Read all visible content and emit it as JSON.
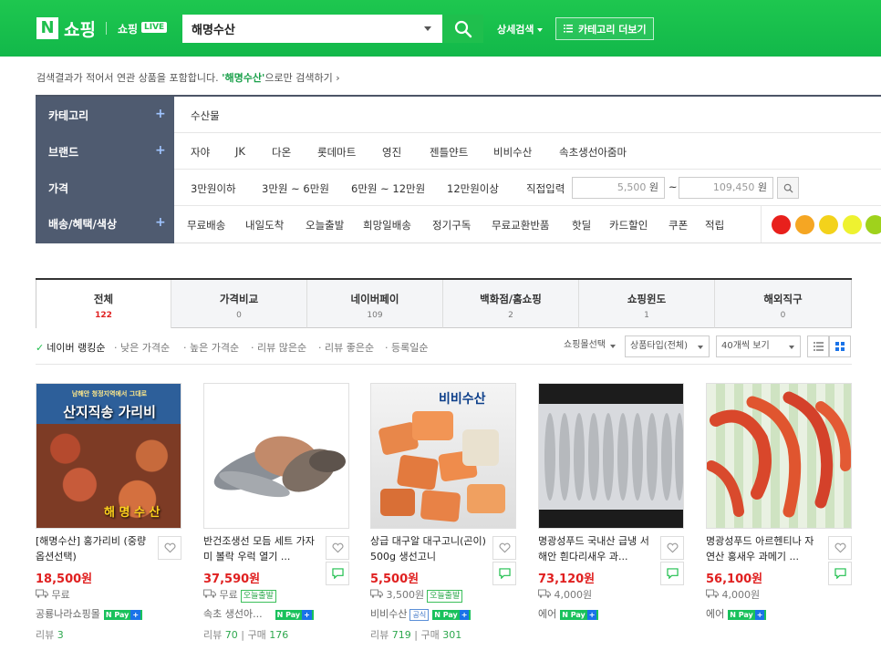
{
  "header": {
    "logo_n": "N",
    "logo_text": "쇼핑",
    "live_text": "쇼핑",
    "live_badge": "LIVE",
    "search_value": "해명수산",
    "advanced_search": "상세검색",
    "category_button": "카테고리 더보기"
  },
  "notice": {
    "prefix": "검색결과가 적어서 연관 상품을 포함합니다.",
    "keyword": "'해명수산'",
    "suffix": "으로만 검색하기 ›"
  },
  "filter": {
    "category": {
      "label": "카테고리",
      "items": [
        "수산물"
      ]
    },
    "brand": {
      "label": "브랜드",
      "items": [
        "자야",
        "JK",
        "다온",
        "롯데마트",
        "영진",
        "젠틀얀트",
        "비비수산",
        "속초생선아줌마"
      ]
    },
    "price": {
      "label": "가격",
      "items": [
        "3만원이하",
        "3만원 ~ 6만원",
        "6만원 ~ 12만원",
        "12만원이상"
      ],
      "direct_label": "직접입력",
      "min": "5,500",
      "max": "109,450",
      "won": "원",
      "tilde": "~"
    },
    "delivery": {
      "label": "배송/혜택/색상",
      "items": [
        "무료배송",
        "내일도착",
        "오늘출발",
        "희망일배송",
        "정기구독",
        "무료교환반품",
        "핫딜",
        "카드할인",
        "쿠폰",
        "적립"
      ],
      "colors": [
        "#e8201c",
        "#f5a623",
        "#f3d21b",
        "#eef230",
        "#9fd21c"
      ]
    },
    "plus": "+"
  },
  "tabs": [
    {
      "label": "전체",
      "count": "122"
    },
    {
      "label": "가격비교",
      "count": "0"
    },
    {
      "label": "네이버페이",
      "count": "109"
    },
    {
      "label": "백화점/홈쇼핑",
      "count": "2"
    },
    {
      "label": "쇼핑윈도",
      "count": "1"
    },
    {
      "label": "해외직구",
      "count": "0"
    }
  ],
  "sort": {
    "items": [
      "네이버 랭킹순",
      "낮은 가격순",
      "높은 가격순",
      "리뷰 많은순",
      "리뷰 좋은순",
      "등록일순"
    ],
    "mall_select": "쇼핑몰선택",
    "product_type": "상품타입(전체)",
    "page_size": "40개씩 보기"
  },
  "products": [
    {
      "title": "[해명수산] 홍가리비 (중량 옵션선택)",
      "price": "18,500원",
      "shipping": "무료",
      "seller": "공룡나라쇼핑몰",
      "review_label": "리뷰",
      "review": "3",
      "img_text_top": "남해안 청정지역에서 그대로",
      "img_text_mid": "산지직송 가리비",
      "img_text_bottom": "해 명 수 산"
    },
    {
      "title": "반건조생선 모듬 세트 가자미 볼락 우럭 열기 ...",
      "price": "37,590원",
      "shipping": "무료",
      "today": "오늘출발",
      "seller": "속초 생선아...",
      "review_label": "리뷰",
      "review": "70",
      "purchase_label": "구매",
      "purchase": "176"
    },
    {
      "title": "상급 대구알 대구고니(곤이) 500g 생선고니",
      "price": "5,500원",
      "shipping": "3,500원",
      "today": "오늘출발",
      "seller": "비비수산",
      "official": "공식",
      "review_label": "리뷰",
      "review": "719",
      "purchase_label": "구매",
      "purchase": "301",
      "img_brand": "비비수산"
    },
    {
      "title": "명광성푸드 국내산 급냉 서해안 흰다리새우 과...",
      "price": "73,120원",
      "shipping": "4,000원",
      "seller": "에어"
    },
    {
      "title": "명광성푸드 아르헨티나 자연산 홍새우 과메기 ...",
      "price": "56,100원",
      "shipping": "4,000원",
      "seller": "에어"
    }
  ],
  "npay": {
    "label": "N Pay",
    "plus": "+"
  }
}
